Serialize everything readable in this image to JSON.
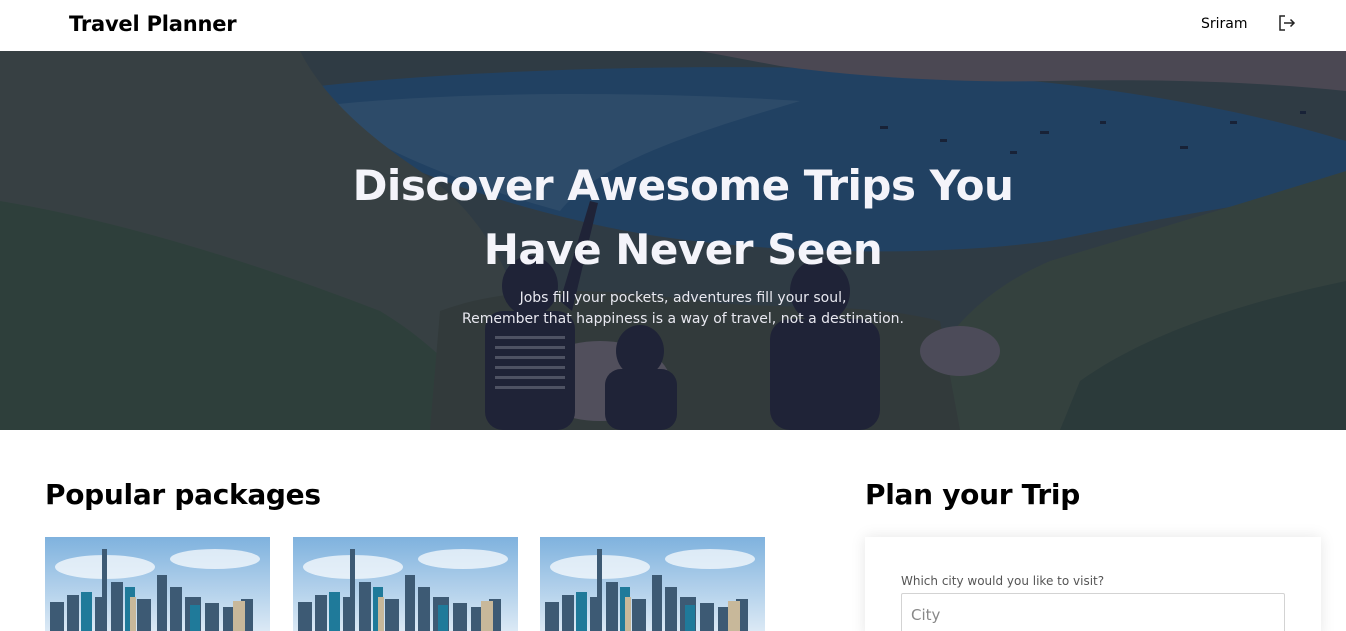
{
  "navbar": {
    "brand": "Travel Planner",
    "user_name": "Sriram",
    "logout_icon": "logout-icon"
  },
  "hero": {
    "title": "Discover Awesome Trips You Have Never Seen",
    "subtitle_line1": "Jobs fill your pockets, adventures fill your soul,",
    "subtitle_line2": "Remember that happiness is a way of travel, not a destination."
  },
  "popular": {
    "title": "Popular packages"
  },
  "plan": {
    "title": "Plan your Trip",
    "city_label": "Which city would you like to visit?",
    "city_placeholder": "City",
    "city_value": ""
  },
  "colors": {
    "overlay": "#161c3a",
    "text_dark": "#000000"
  }
}
